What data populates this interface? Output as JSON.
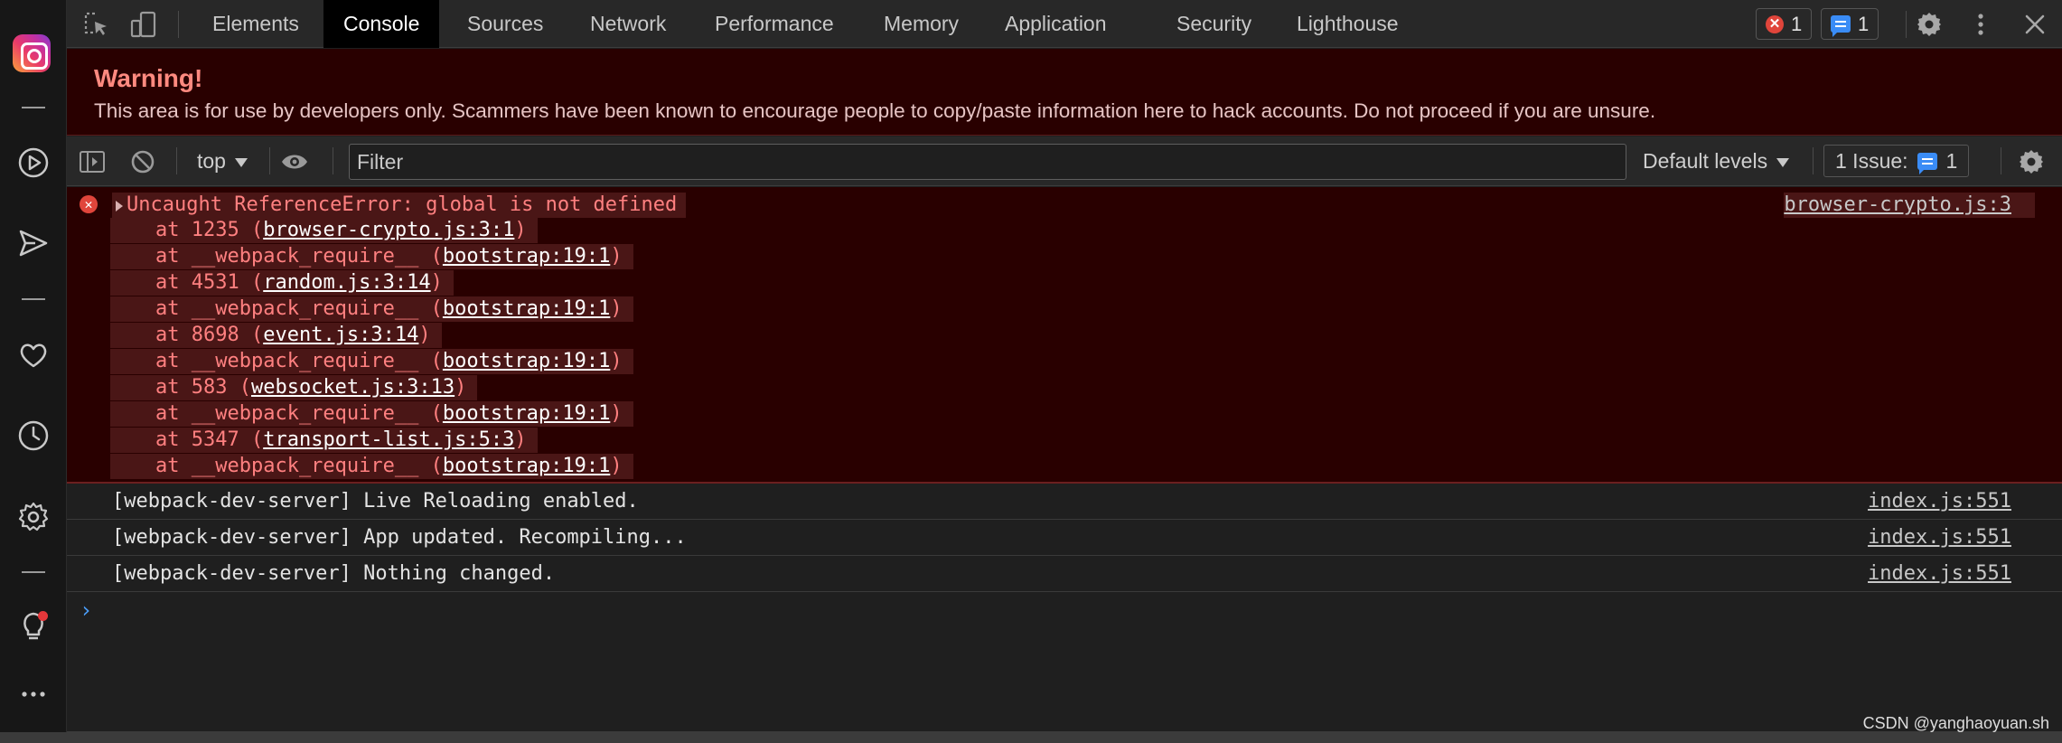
{
  "tabs": [
    "Elements",
    "Console",
    "Sources",
    "Network",
    "Performance",
    "Memory",
    "Application",
    "Security",
    "Lighthouse"
  ],
  "active_tab": "Console",
  "counters": {
    "errors": "1",
    "messages": "1"
  },
  "warning": {
    "title": "Warning!",
    "text": "This area is for use by developers only. Scammers have been known to encourage people to copy/paste information here to hack accounts. Do not proceed if you are unsure."
  },
  "toolbar": {
    "context": "top",
    "filter_placeholder": "Filter",
    "levels_label": "Default levels",
    "issues_label": "1 Issue:",
    "issues_count": "1"
  },
  "error": {
    "message": "Uncaught ReferenceError: global is not defined",
    "source": "browser-crypto.js:3",
    "stack": [
      {
        "prefix": "at 1235 (",
        "link": "browser-crypto.js:3:1",
        "suffix": ")"
      },
      {
        "prefix": "at __webpack_require__ (",
        "link": "bootstrap:19:1",
        "suffix": ")"
      },
      {
        "prefix": "at 4531 (",
        "link": "random.js:3:14",
        "suffix": ")"
      },
      {
        "prefix": "at __webpack_require__ (",
        "link": "bootstrap:19:1",
        "suffix": ")"
      },
      {
        "prefix": "at 8698 (",
        "link": "event.js:3:14",
        "suffix": ")"
      },
      {
        "prefix": "at __webpack_require__ (",
        "link": "bootstrap:19:1",
        "suffix": ")"
      },
      {
        "prefix": "at 583 (",
        "link": "websocket.js:3:13",
        "suffix": ")"
      },
      {
        "prefix": "at __webpack_require__ (",
        "link": "bootstrap:19:1",
        "suffix": ")"
      },
      {
        "prefix": "at 5347 (",
        "link": "transport-list.js:5:3",
        "suffix": ")"
      },
      {
        "prefix": "at __webpack_require__ (",
        "link": "bootstrap:19:1",
        "suffix": ")"
      }
    ]
  },
  "logs": [
    {
      "text": "[webpack-dev-server] Live Reloading enabled.",
      "source": "index.js:551"
    },
    {
      "text": "[webpack-dev-server] App updated. Recompiling...",
      "source": "index.js:551"
    },
    {
      "text": "[webpack-dev-server] Nothing changed.",
      "source": "index.js:551"
    }
  ],
  "prompt_symbol": "›",
  "watermark": "CSDN @yanghaoyuan.sh",
  "rail_icons": [
    "instagram-icon",
    "play-icon",
    "send-icon",
    "heart-icon",
    "history-icon",
    "settings-icon",
    "lightbulb-icon",
    "more-icon"
  ],
  "colors": {
    "error_bg": "#290000",
    "error_text": "#ff8080",
    "accent_blue": "#3a8cf6",
    "active_tab_bg": "#000000"
  }
}
